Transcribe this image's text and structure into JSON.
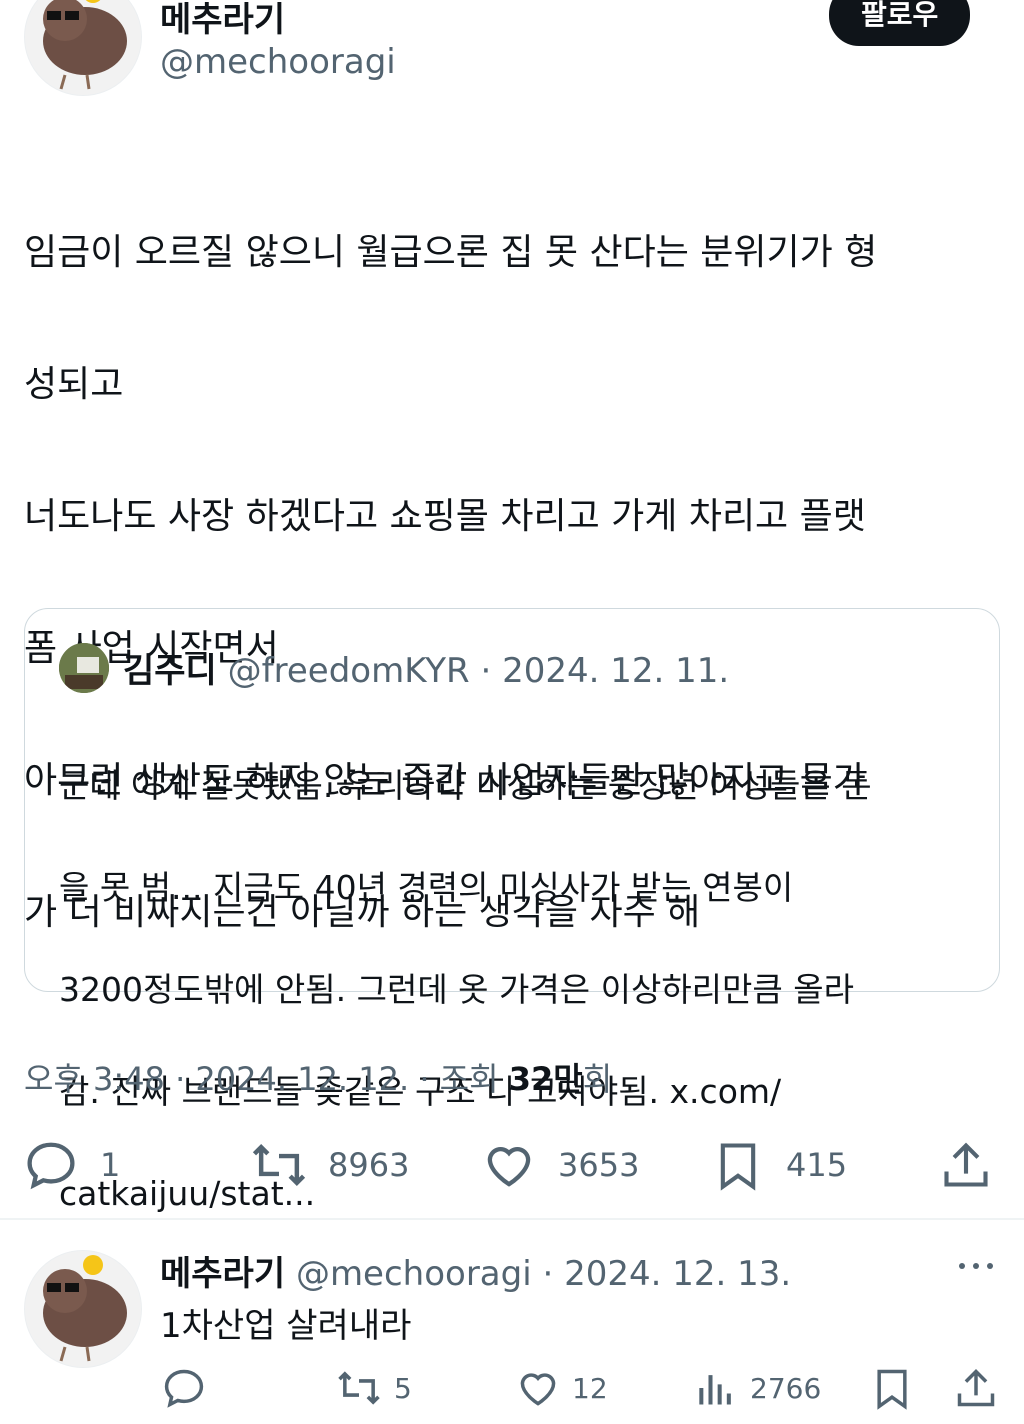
{
  "main_tweet": {
    "author_name": "메추라기",
    "author_handle": "@mechooragi",
    "follow_label": "팔로우",
    "lines": [
      "임금이 오르질 않으니 월급으론 집 못 산다는 분위기가 형",
      "성되고",
      "너도나도 사장 하겠다고 쇼핑몰 차리고 가게 차리고 플랫",
      "폼 사업 시작면서",
      "아무런 생산도 하지 않는 중간 사업자들만 많아지고 물가",
      "가 더 비싸지는건 아닐까 하는 생각을 자주 해"
    ],
    "timestamp": "오후 3:48 · 2024. 12. 12. · 조회 ",
    "views_value": "32만",
    "views_suffix": "회",
    "actions": {
      "replies": "1",
      "reposts": "8963",
      "likes": "3653",
      "bookmarks": "415"
    }
  },
  "quoted_tweet": {
    "author_name": "김주디",
    "author_handle": "@freedomKYR",
    "date": "· 2024. 12. 11.",
    "lines": [
      "근데 이게 잘못됐음. 우리나라 미싱하는 중장년 여성들은 돈",
      "을 못 범... 지금도 40년 경력의 미싱사가 받는 연봉이",
      "3200정도밖에 안됨. 그런데 옷 가격은 이상하리만큼 올라",
      "감. 진짜 브랜드들 좆같은 구조 다 고쳐야됨. x.com/",
      "catkaijuu/stat..."
    ]
  },
  "reply_tweet": {
    "author_name": "메추라기",
    "author_handle": "@mechooragi",
    "date": "· 2024. 12. 13.",
    "text": "1차산업 살려내라",
    "actions": {
      "replies": "",
      "reposts": "5",
      "likes": "12",
      "views": "2766"
    }
  },
  "colors": {
    "text": "#0f1419",
    "muted": "#536471",
    "border": "#cfd9de",
    "button_bg": "#0f1419"
  },
  "icons": [
    "reply-icon",
    "repost-icon",
    "like-icon",
    "bookmark-icon",
    "share-icon",
    "views-icon",
    "more-icon"
  ]
}
